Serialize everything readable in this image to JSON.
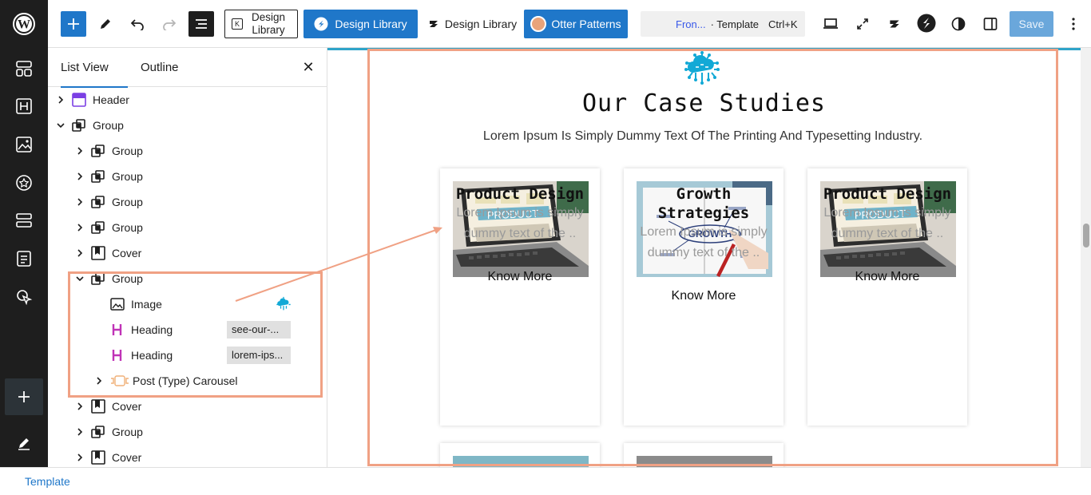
{
  "toolbar": {
    "design_library_boxed": "Design Library",
    "design_library_primary": "Design Library",
    "design_library_secondary": "Design Library",
    "otter_patterns": "Otter Patterns",
    "command": {
      "page": "Fron...",
      "separator": "· Template",
      "shortcut": "Ctrl+K"
    },
    "save": "Save"
  },
  "panel": {
    "tabs": [
      "List View",
      "Outline"
    ],
    "rows": [
      {
        "label": "Header",
        "icon": "template-part-icon",
        "chevron": "›"
      },
      {
        "label": "Group",
        "icon": "group-icon",
        "chevron": "⌄"
      },
      {
        "label": "Group",
        "icon": "group-icon",
        "chevron": "›"
      },
      {
        "label": "Group",
        "icon": "group-icon",
        "chevron": "›"
      },
      {
        "label": "Group",
        "icon": "group-icon",
        "chevron": "›"
      },
      {
        "label": "Group",
        "icon": "group-icon",
        "chevron": "›"
      },
      {
        "label": "Cover",
        "icon": "cover-icon",
        "chevron": "›"
      },
      {
        "label": "Group",
        "icon": "group-icon",
        "chevron": "⌄"
      },
      {
        "label": "Image",
        "icon": "image-icon",
        "chevron": ""
      },
      {
        "label": "Heading",
        "icon": "heading-icon",
        "chevron": "",
        "badge": "see-our-..."
      },
      {
        "label": "Heading",
        "icon": "heading-icon",
        "chevron": "",
        "badge": "lorem-ips..."
      },
      {
        "label": "Post (Type) Carousel",
        "icon": "carousel-icon",
        "chevron": "›"
      },
      {
        "label": "Cover",
        "icon": "cover-icon",
        "chevron": "›"
      },
      {
        "label": "Group",
        "icon": "group-icon",
        "chevron": "›"
      },
      {
        "label": "Cover",
        "icon": "cover-icon",
        "chevron": "›"
      }
    ]
  },
  "canvas": {
    "title": "Our Case Studies",
    "subtitle": "Lorem Ipsum Is Simply Dummy Text Of The Printing And Typesetting Industry.",
    "cards": [
      {
        "title": "Product Design",
        "text": "Lorem Ipsum is simply dummy text of the ..",
        "button": "Know More",
        "image": "product-laptop"
      },
      {
        "title": "Growth Strategies",
        "text": "Lorem Ipsum is simply dummy text of the ..",
        "button": "Know More",
        "image": "growth-notebook"
      },
      {
        "title": "Product Design",
        "text": "Lorem Ipsum is simply dummy text of the ..",
        "button": "Know More",
        "image": "product-laptop"
      }
    ],
    "image_labels": {
      "product": "PRODUCT",
      "growth": "GROWTH"
    }
  },
  "footer": {
    "breadcrumb": "Template"
  },
  "colors": {
    "accent": "#1f77c9",
    "highlight": "#f0a184",
    "rail": "#1e1e1e",
    "logo": "#12a9d6"
  }
}
